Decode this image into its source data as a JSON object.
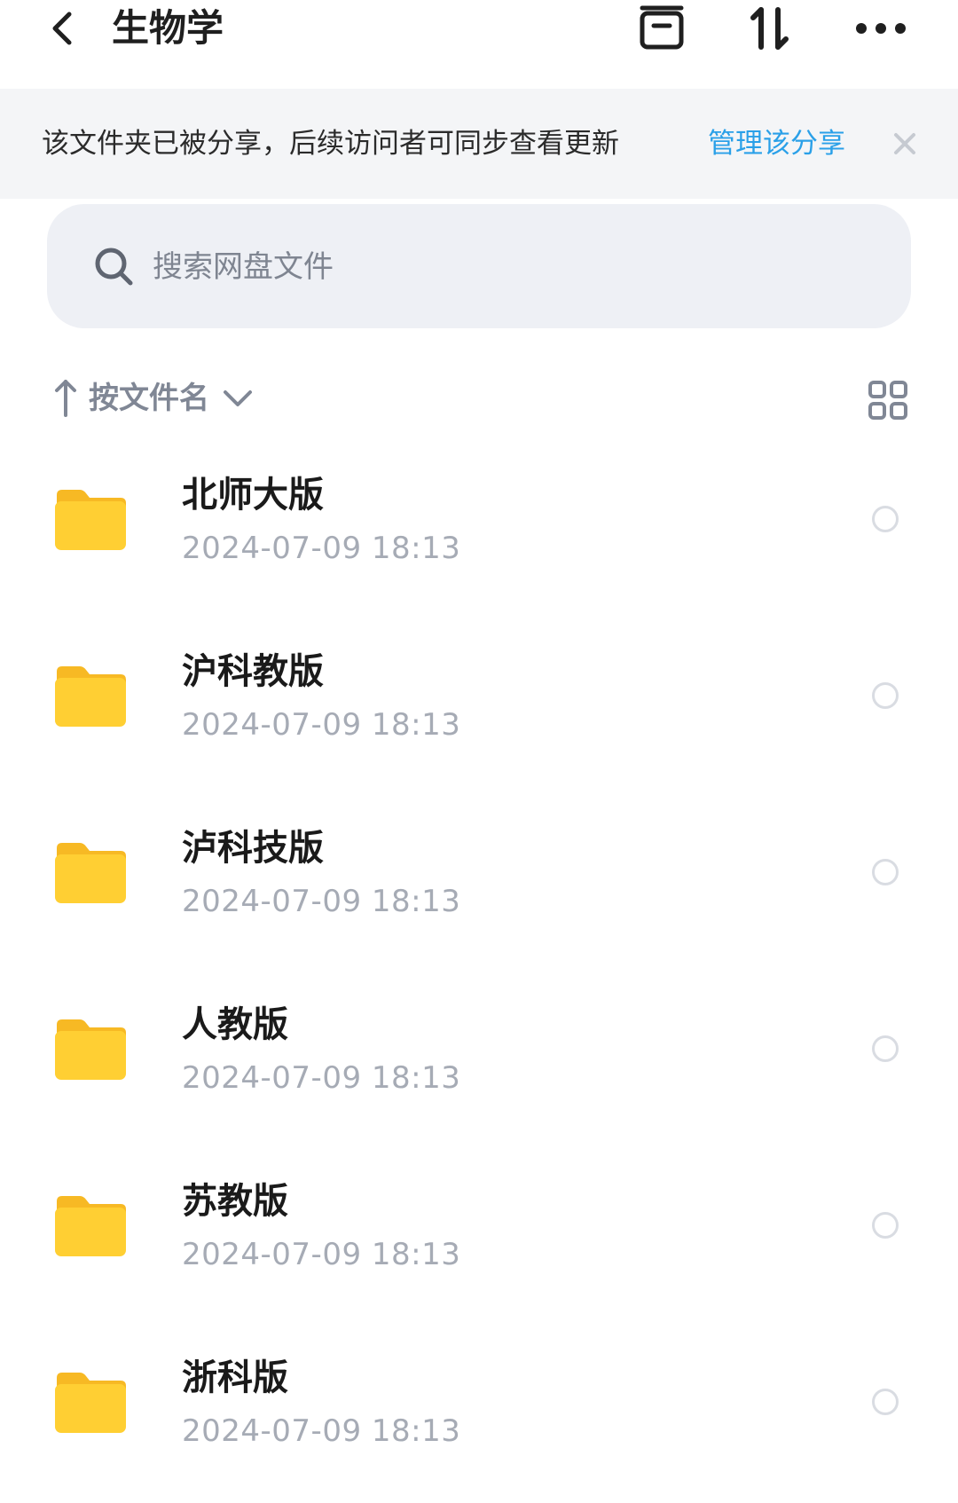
{
  "header": {
    "title": "生物学",
    "back_icon": "chevron-left-icon",
    "actions": [
      "archive-box-icon",
      "sort-arrows-icon",
      "more-dots-icon"
    ]
  },
  "share_banner": {
    "text": "该文件夹已被分享，后续访问者可同步查看更新",
    "link": "管理该分享",
    "close_icon": "close-icon",
    "link_color": "#2aa0e8"
  },
  "search": {
    "placeholder": "搜索网盘文件"
  },
  "sort_bar": {
    "label": "按文件名",
    "direction_icon": "arrow-up-icon",
    "dropdown_icon": "chevron-down-icon",
    "view_icon": "grid-view-icon"
  },
  "files": [
    {
      "name": "北师大版",
      "date": "2024-07-09  18:13"
    },
    {
      "name": "沪科教版",
      "date": "2024-07-09  18:13"
    },
    {
      "name": "泸科技版",
      "date": "2024-07-09  18:13"
    },
    {
      "name": "人教版",
      "date": "2024-07-09  18:13"
    },
    {
      "name": "苏教版",
      "date": "2024-07-09  18:13"
    },
    {
      "name": "浙科版",
      "date": "2024-07-09  18:13"
    }
  ],
  "colors": {
    "folder": "#ffcf33",
    "folder_tab": "#f7b924",
    "date_text": "#a6abb5"
  }
}
